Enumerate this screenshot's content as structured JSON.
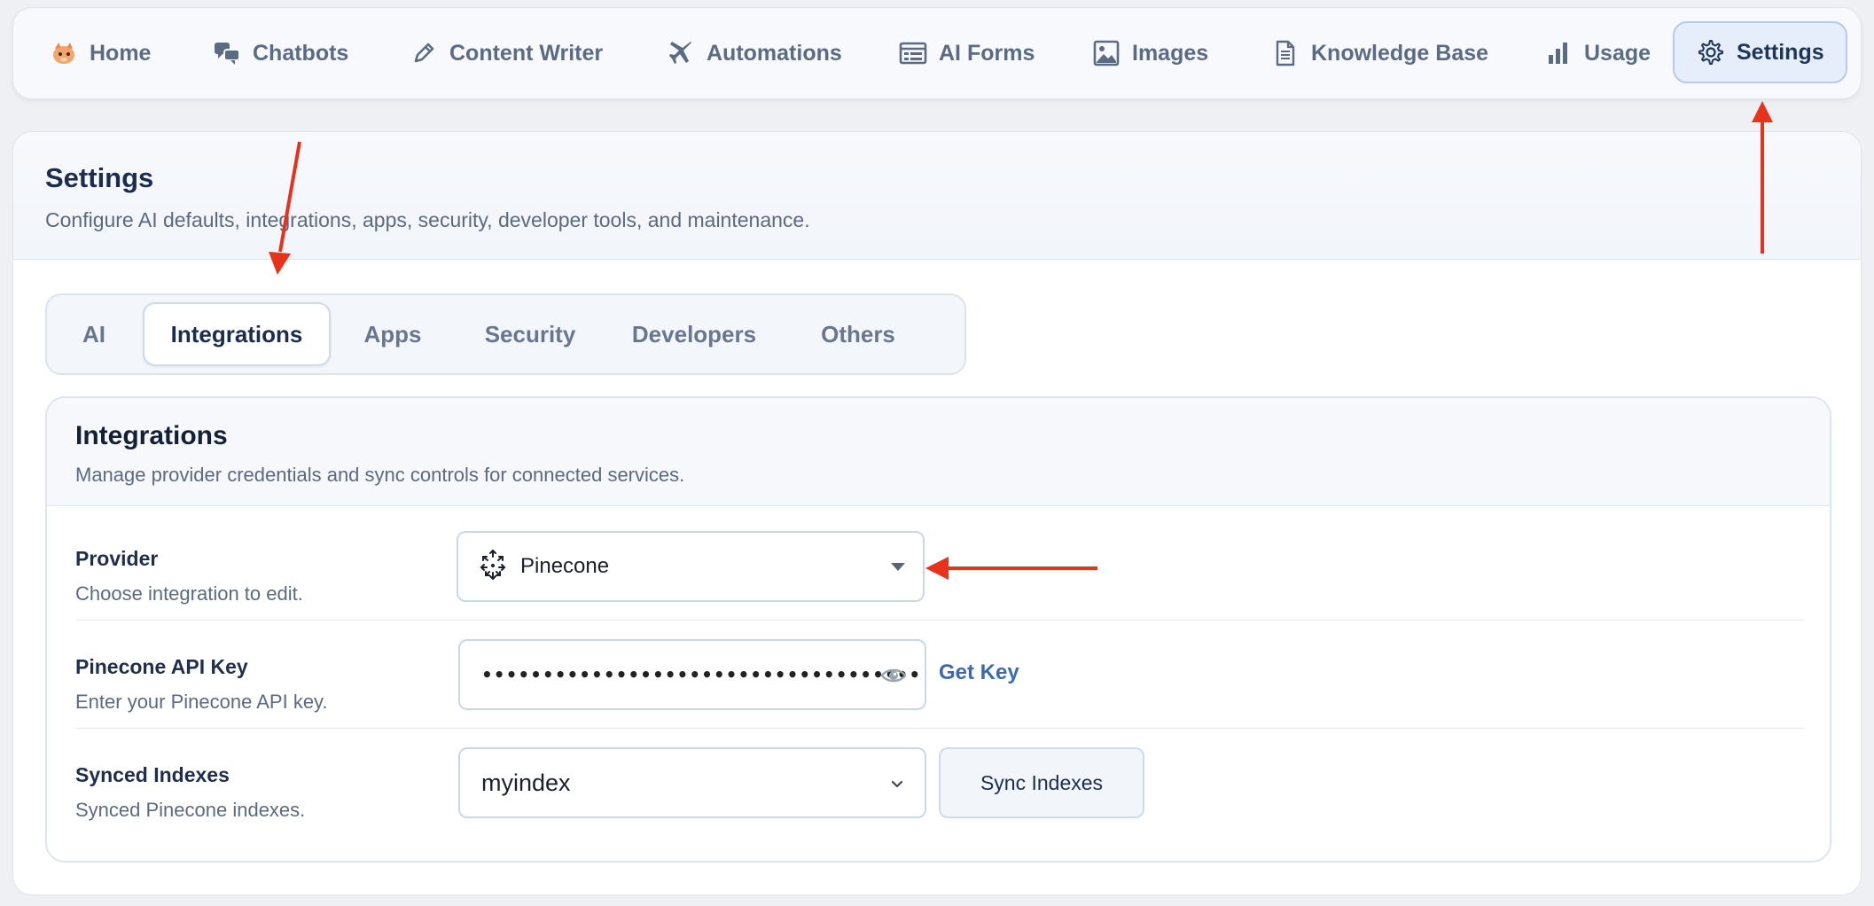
{
  "nav": {
    "items": [
      {
        "label": "Home",
        "icon": "mascot-icon"
      },
      {
        "label": "Chatbots",
        "icon": "chat-bubbles-icon"
      },
      {
        "label": "Content Writer",
        "icon": "pencil-icon"
      },
      {
        "label": "Automations",
        "icon": "airplane-icon"
      },
      {
        "label": "AI Forms",
        "icon": "form-icon"
      },
      {
        "label": "Images",
        "icon": "image-icon"
      },
      {
        "label": "Knowledge Base",
        "icon": "document-icon"
      },
      {
        "label": "Usage",
        "icon": "bar-chart-icon"
      },
      {
        "label": "Settings",
        "icon": "gear-icon",
        "active": true
      }
    ]
  },
  "page": {
    "title": "Settings",
    "subtitle": "Configure AI defaults, integrations, apps, security, developer tools, and maintenance."
  },
  "tabs": [
    {
      "label": "AI"
    },
    {
      "label": "Integrations",
      "active": true
    },
    {
      "label": "Apps"
    },
    {
      "label": "Security"
    },
    {
      "label": "Developers"
    },
    {
      "label": "Others"
    }
  ],
  "integrations": {
    "title": "Integrations",
    "subtitle": "Manage provider credentials and sync controls for connected services.",
    "provider": {
      "label": "Provider",
      "help": "Choose integration to edit.",
      "value": "Pinecone",
      "icon": "pinecone-icon"
    },
    "api_key": {
      "label": "Pinecone API Key",
      "help": "Enter your Pinecone API key.",
      "masked_value": "••••••••••••••••••••••••••••••••••••",
      "link": "Get Key"
    },
    "indexes": {
      "label": "Synced Indexes",
      "help": "Synced Pinecone indexes.",
      "value": "myindex",
      "button": "Sync Indexes"
    }
  },
  "colors": {
    "accent": "#3a6bb0",
    "active_nav_bg": "#e6eefb",
    "annotation_arrow": "#e8321c"
  }
}
